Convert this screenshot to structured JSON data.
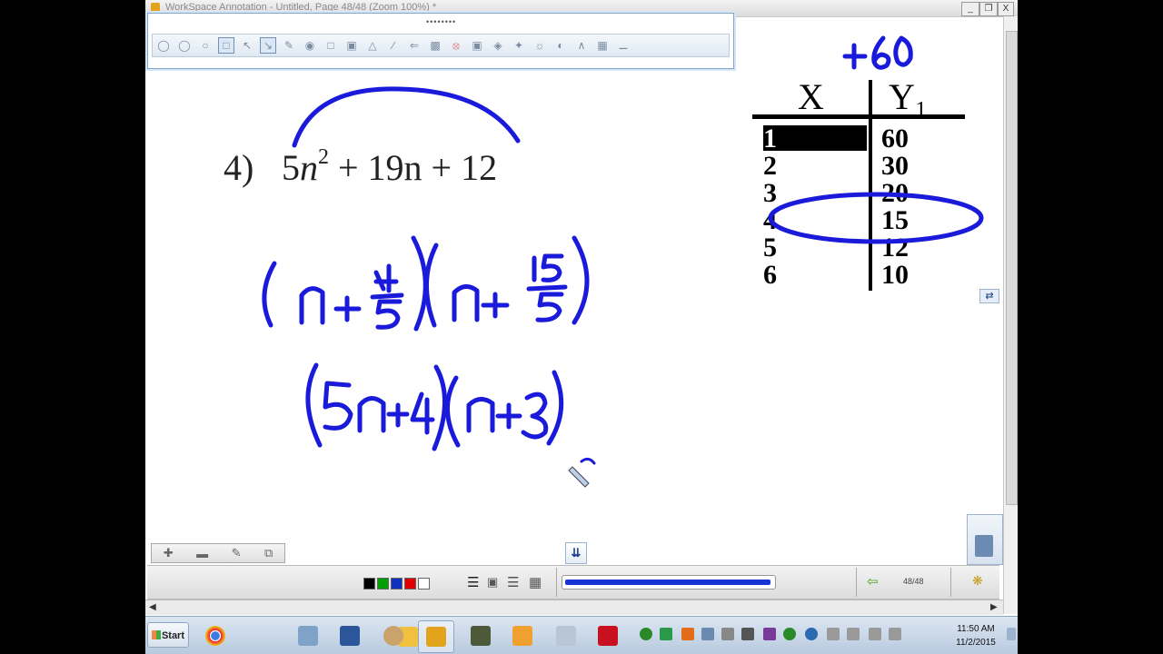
{
  "window": {
    "title": "WorkSpace Annotation - Untitled, Page 48/48  (Zoom 100%) *",
    "minimize_label": "_",
    "restore_label": "❐",
    "close_label": "X",
    "toolbar_grip": "••••••••"
  },
  "toolbar": {
    "icons": [
      "undo-icon",
      "redo-icon",
      "mouse-icon",
      "select-page-icon",
      "pointer-icon",
      "pen-tool-icon",
      "highlighter-icon",
      "camera-icon",
      "blank-page-icon",
      "insert-image-icon",
      "shape-icon",
      "line-icon",
      "arrow-icon",
      "screen-capture-icon",
      "eraser-icon",
      "text-icon",
      "fill-icon",
      "magic-pen-icon",
      "spotlight-icon",
      "protractor-icon",
      "compass-icon",
      "calculator-icon",
      "ruler-icon"
    ]
  },
  "problem": {
    "number": "4)",
    "coef": "5",
    "var": "n",
    "exp": "2",
    "rest": "+ 19n + 12"
  },
  "handwriting": {
    "factor_step1": "(n + 4/5)(n + 15/5)",
    "factor_step2": "(5n+4)(n+3)",
    "ac_product": "+60"
  },
  "calc_table": {
    "col_x": "X",
    "col_y": "Y₁",
    "rows": [
      {
        "x": "1",
        "y": "60"
      },
      {
        "x": "2",
        "y": "30"
      },
      {
        "x": "3",
        "y": "20"
      },
      {
        "x": "4",
        "y": "15"
      },
      {
        "x": "5",
        "y": "12"
      },
      {
        "x": "6",
        "y": "10"
      }
    ],
    "highlighted_row": 3
  },
  "bottom_bar": {
    "page_count": "48/48",
    "progress": 1.0,
    "swatch_colors": [
      "#000000",
      "#00a000",
      "#1030c0",
      "#e00000",
      "#ffffff"
    ]
  },
  "page_tools": [
    "add-page-icon",
    "remove-page-icon",
    "edit-page-icon",
    "duplicate-page-icon"
  ],
  "taskbar": {
    "start_label": "Start",
    "apps": [
      "chrome-icon",
      "file-explorer-icon",
      "notepad-icon",
      "word-icon",
      "paint-icon",
      "workspace-icon",
      "minecraft-icon",
      "outlook-icon",
      "calculator-icon",
      "acrobat-icon"
    ],
    "time": "11:50 AM",
    "date": "11/2/2015"
  }
}
